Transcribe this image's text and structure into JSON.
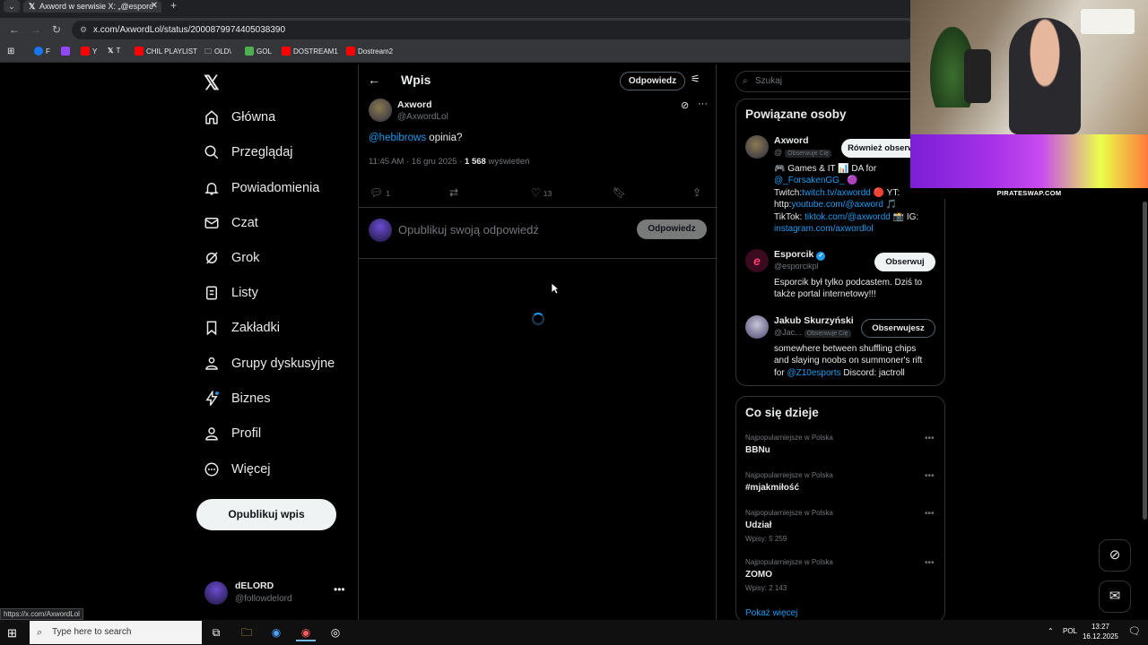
{
  "browser": {
    "tab_title": "Axword w serwisie X: „@esporc",
    "url": "x.com/AxwordLol/status/2000879974405038390",
    "bookmarks": [
      "F",
      "Y",
      "T",
      "CHIL PLAYLIST",
      "OLD\\",
      "GOL",
      "DOSTREAM1",
      "Dostream2"
    ],
    "status_url": "https://x.com/AxwordLol"
  },
  "nav": {
    "items": [
      "Główna",
      "Przeglądaj",
      "Powiadomienia",
      "Czat",
      "Grok",
      "Listy",
      "Zakładki",
      "Grupy dyskusyjne",
      "Biznes",
      "Profil",
      "Więcej"
    ],
    "post_button": "Opublikuj wpis",
    "me_name": "dELORD",
    "me_handle": "@followdelord"
  },
  "main": {
    "title": "Wpis",
    "reply_top_button": "Odpowiedz",
    "author_name": "Axword",
    "author_handle": "@AxwordLol",
    "mention": "@hebibrows",
    "text": "opinia?",
    "time": "11:45 AM · 16 gru 2025 · ",
    "views_count": "1 568",
    "views_label": "wyświetleń",
    "reply_count": "1",
    "like_count": "13",
    "reply_placeholder": "Opublikuj swoją odpowiedź",
    "reply_button": "Odpowiedz"
  },
  "right": {
    "search_placeholder": "Szukaj",
    "related_title": "Powiązane osoby",
    "people": [
      {
        "name": "Axword",
        "handle": "@",
        "follows_badge": "Obserwuje Cię",
        "button": "Również obserwuj",
        "bio1": "🎮 Games & IT 📊 DA for",
        "bio2": "@_ForsakenGG_ 🟣",
        "bio3a": "Twitch:",
        "bio3b": "twitch.tv/axwordd",
        "bio3c": "🔴 YT:",
        "bio4a": "http:",
        "bio4b": "youtube.com/@axword",
        "bio4c": "🎵",
        "bio5a": "TikTok:",
        "bio5b": "tiktok.com/@axwordd",
        "bio5c": "📸 IG:",
        "bio6": "instagram.com/axwordlol"
      },
      {
        "name": "Esporcik",
        "handle": "@esporcikpl",
        "button": "Obserwuj",
        "bio1": "Esporcik był tylko podcastem. Dziś to",
        "bio2": "także portal internetowy!!!"
      },
      {
        "name": "Jakub Skurzyński",
        "handle": "@Jac...",
        "follows_badge": "Obserwuje Cię",
        "button": "Obserwujesz",
        "bio1": "somewhere between shuffling chips",
        "bio2": "and slaying noobs on summoner's rift",
        "bio3a": "for",
        "bio3b": "@Z10esports",
        "bio3c": "Discord: jactroll"
      }
    ],
    "trends_title": "Co się dzieje",
    "trends": [
      {
        "label": "Najpopularniejsze w Polska",
        "name": "BBNu",
        "count": ""
      },
      {
        "label": "Najpopularniejsze w Polska",
        "name": "#mjakmiłość",
        "count": ""
      },
      {
        "label": "Najpopularniejsze w Polska",
        "name": "Udział",
        "count": "Wpisy: 5 259"
      },
      {
        "label": "Najpopularniejsze w Polska",
        "name": "ZOMO",
        "count": "Wpisy: 2 143"
      }
    ],
    "show_more": "Pokaż więcej"
  },
  "overlay": {
    "banner_label": "PIRATESWAP.COM"
  },
  "taskbar": {
    "search_placeholder": "Type here to search",
    "lang": "POL",
    "time": "13:27",
    "date": "16.12.2025"
  },
  "colors": {
    "accent": "#1d9bf0",
    "background": "#000000",
    "border": "#2f3336",
    "muted": "#71767b"
  }
}
